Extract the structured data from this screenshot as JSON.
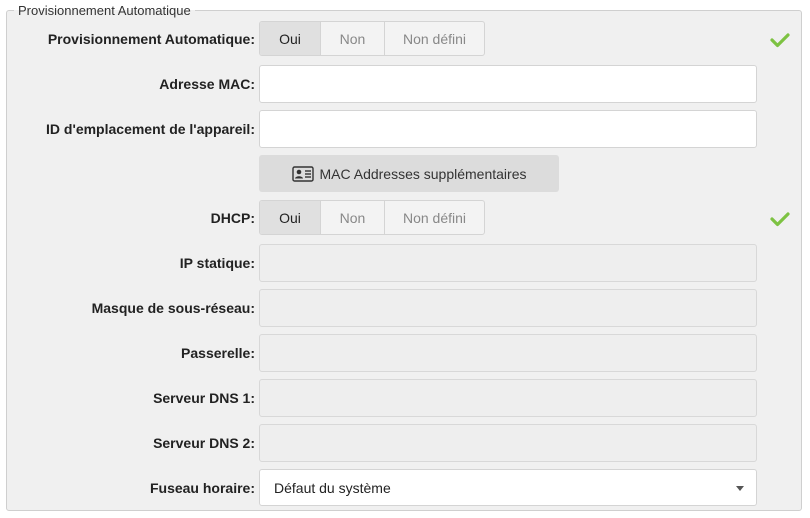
{
  "fieldset": {
    "legend": "Provisionnement Automatique"
  },
  "auto_provisioning": {
    "label": "Provisionnement Automatique:",
    "options": [
      "Oui",
      "Non",
      "Non défini"
    ],
    "selected": "Oui",
    "status": "valid"
  },
  "mac_address": {
    "label": "Adresse MAC:",
    "value": ""
  },
  "device_location_id": {
    "label": "ID d'emplacement de l'appareil:",
    "value": ""
  },
  "mac_addresses_button": {
    "label": "MAC Addresses supplémentaires",
    "icon": "contact-card-icon"
  },
  "dhcp": {
    "label": "DHCP:",
    "options": [
      "Oui",
      "Non",
      "Non défini"
    ],
    "selected": "Oui",
    "status": "valid"
  },
  "static_ip": {
    "label": "IP statique:",
    "value": ""
  },
  "subnet_mask": {
    "label": "Masque de sous-réseau:",
    "value": ""
  },
  "gateway": {
    "label": "Passerelle:",
    "value": ""
  },
  "dns1": {
    "label": "Serveur DNS 1:",
    "value": ""
  },
  "dns2": {
    "label": "Serveur DNS 2:",
    "value": ""
  },
  "timezone": {
    "label": "Fuseau horaire:",
    "value": "Défaut du système"
  },
  "colors": {
    "check": "#7dc242",
    "panel": "#f0f0f0",
    "active_option": "#e0e0e0"
  }
}
